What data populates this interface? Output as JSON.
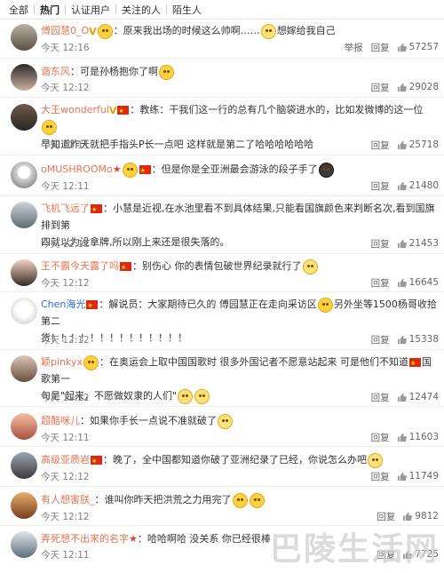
{
  "tabs": [
    "全部",
    "热门",
    "认证用户",
    "关注的人",
    "陌生人"
  ],
  "actions": {
    "report": "举报",
    "reply": "回复"
  },
  "comments": [
    {
      "user": "傅园慧0_O",
      "text": "：原来我出场的时候这么帅啊……",
      "text2": "想嫁给我自己",
      "time": "今天 12:16",
      "likes": "57257",
      "user_color": "orange"
    },
    {
      "user": "谐东风",
      "text": "：可是孙杨抱你了啊",
      "time": "今天 12:12",
      "likes": "29028",
      "user_color": "orange"
    },
    {
      "user": "大王wonderful",
      "text": "：教练：干我们这一行的总有几个脑袋进水的，比如发微博的这一位",
      "text2": "早知道昨天就把手指头P长一点吧 这样就是第二了哈哈哈哈哈哈",
      "time": "今天 12:11",
      "likes": "25718",
      "user_color": "orange"
    },
    {
      "user": "oMUSHROOMo",
      "text": "：但是你是全亚洲最会游泳的段子手了",
      "time": "今天 12:11",
      "likes": "21480",
      "user_color": "orange"
    },
    {
      "user": "飞机飞远了",
      "text": "：小慧是近视,在水池里看不到具体结果,只能看国旗颜色来判断名次,看到国旗排到第",
      "text2": "四就以为没拿牌,所以刚上来还是很失落的。",
      "time": "今天 12:11",
      "likes": "21453",
      "user_color": "orange"
    },
    {
      "user": "王不霸今天露了吗",
      "text": "：别伤心 你的表情包破世界纪录就行了",
      "time": "今天 12:12",
      "likes": "16645",
      "user_color": "orange"
    },
    {
      "user": "Chen海光",
      "text": "：解说员：大家期待已久的 傅园慧正在走向采访区",
      "text_b": "另外坐等1500杨哥收拾第二",
      "text2": "货！！！！！！！！！！！！！！",
      "time": "今天 12:12",
      "likes": "15338",
      "user_color": "blue"
    },
    {
      "user": "颖pinkyx",
      "text": "：在奥运会上取中国国歌时 很多外国记者不愿意站起来 可是他们不知道",
      "text_b": "国歌第一",
      "text2": "句是\"起来，不愿做奴隶的人们\"",
      "time": "今天 12:12",
      "likes": "12474",
      "user_color": "orange"
    },
    {
      "user": "超酷咪儿",
      "text": "：如果你手长一点说不准就破了",
      "time": "今天 12:11",
      "likes": "11603",
      "user_color": "orange"
    },
    {
      "user": "高级亚质岩",
      "text": "：晚了，全中国都知道你破了亚洲纪录了已经，你说怎么办吧",
      "time": "今天 12:12",
      "likes": "11749",
      "user_color": "orange"
    },
    {
      "user": "有人想害朕_",
      "text": "：谁叫你昨天把洪荒之力用完了",
      "time": "今天 12:12",
      "likes": "9812",
      "user_color": "orange"
    },
    {
      "user": "弄死想不出来的名字",
      "text": "：哈哈啊哈 没关系 你已经很棒",
      "time": "今天 12:11",
      "likes": "7725",
      "user_color": "orange"
    }
  ],
  "watermark": "巴陵生活网"
}
